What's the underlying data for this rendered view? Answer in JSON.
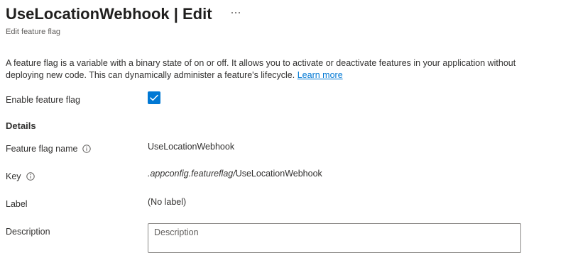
{
  "header": {
    "title": "UseLocationWebhook | Edit",
    "more_label": "···",
    "subtitle": "Edit feature flag"
  },
  "intro": {
    "text": "A feature flag is a variable with a binary state of on or off. It allows you to activate or deactivate features in your application without deploying new code. This can dynamically administer a feature's lifecycle.",
    "link_label": "Learn more"
  },
  "enable": {
    "label": "Enable feature flag",
    "checked": true
  },
  "details": {
    "heading": "Details",
    "name_label": "Feature flag name",
    "name_value": "UseLocationWebhook",
    "key_label": "Key",
    "key_prefix": ".appconfig.featureflag/",
    "key_suffix": "UseLocationWebhook",
    "label_label": "Label",
    "label_value": "(No label)",
    "description_label": "Description",
    "description_value": "",
    "description_placeholder": "Description"
  },
  "colors": {
    "accent": "#0078d4",
    "text": "#323130",
    "border": "#8a8886"
  },
  "icons": {
    "more": "more-horizontal-icon",
    "info": "info-icon",
    "check": "checkmark-icon"
  }
}
